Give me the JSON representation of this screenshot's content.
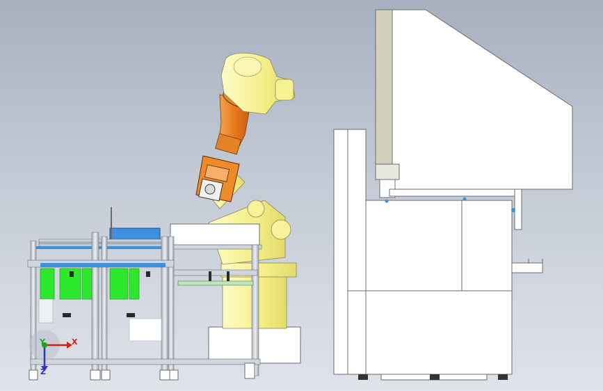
{
  "triad": {
    "x_label": "X",
    "y_label": "Y",
    "z_label": "Z",
    "colors": {
      "x": "#d81c1c",
      "y": "#1ea51e",
      "z": "#2a35c8"
    }
  },
  "palette": {
    "background_top": "#a7b0bf",
    "background_bottom": "#dfe3ea",
    "robot_body": "#f7f494",
    "robot_arm": "#f08a1e",
    "frame_aluminum": "#cfd6de",
    "conveyor_rollers": "#3d8fe0",
    "green_parts": "#2ee82e",
    "machine_panel": "#ffffff",
    "machine_outline": "#6b6b6b",
    "machine_hood_edge": "#c8c6b2"
  },
  "components": [
    {
      "name": "conveyor-frame"
    },
    {
      "name": "industrial-robot"
    },
    {
      "name": "machine-cabinet"
    },
    {
      "name": "coordinate-triad"
    }
  ]
}
